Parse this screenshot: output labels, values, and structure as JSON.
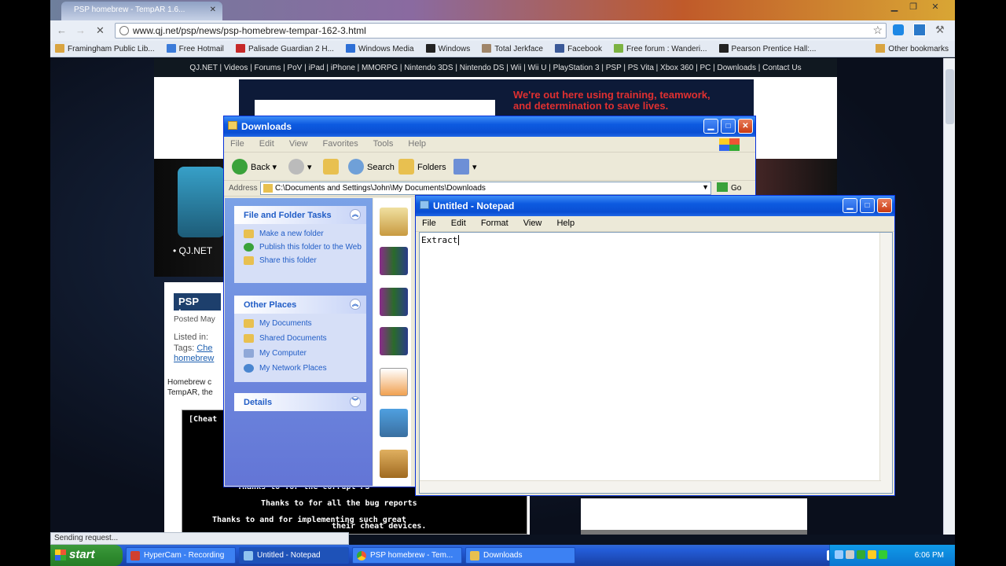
{
  "browser": {
    "tab_title": "PSP homebrew - TempAR 1.6...",
    "url": "www.qj.net/psp/news/psp-homebrew-tempar-162-3.html",
    "bookmarks": [
      "Framingham Public Lib...",
      "Free Hotmail",
      "Palisade Guardian 2 H...",
      "Windows Media",
      "Windows",
      "Total Jerkface",
      "Facebook",
      "Free forum : Wanderi...",
      "Pearson Prentice Hall:..."
    ],
    "other_bookmarks": "Other bookmarks",
    "status": "Sending request..."
  },
  "webpage": {
    "nav": "QJ.NET | Videos | Forums | PoV | iPad | iPhone | MMORPG | Nintendo 3DS | Nintendo DS | Wii | Wii U | PlayStation 3 | PSP | PS Vita | Xbox 360 | PC | Downloads | Contact Us",
    "ad_line1": "We're out here using training, teamwork,",
    "ad_line2": "and determination to save lives.",
    "site_label": "• QJ.NET",
    "article_title": "PSP hom",
    "posted": "Posted May",
    "listed_in": "Listed in:",
    "tags_label": "Tags:",
    "tags_link": "Che",
    "homebrew_link": "homebrew",
    "body1": "Homebrew c",
    "body2": "TempAR, the",
    "cheat_header": "[Cheat",
    "cheat_lines": [
      "Thanks to        for the corrupt PS",
      "Thanks to      for all the bug reports",
      "Thanks to       and        for implementing such great",
      "their cheat devices."
    ]
  },
  "explorer": {
    "title": "Downloads",
    "menu": [
      "File",
      "Edit",
      "View",
      "Favorites",
      "Tools",
      "Help"
    ],
    "toolbar": {
      "back": "Back",
      "search": "Search",
      "folders": "Folders"
    },
    "address_label": "Address",
    "address": "C:\\Documents and Settings\\John\\My Documents\\Downloads",
    "go": "Go",
    "tasks_title": "File and Folder Tasks",
    "tasks": [
      "Make a new folder",
      "Publish this folder to the Web",
      "Share this folder"
    ],
    "places_title": "Other Places",
    "places": [
      "My Documents",
      "Shared Documents",
      "My Computer",
      "My Network Places"
    ],
    "details_title": "Details"
  },
  "notepad": {
    "title": "Untitled - Notepad",
    "menu": [
      "File",
      "Edit",
      "Format",
      "View",
      "Help"
    ],
    "text": "Extract"
  },
  "taskbar": {
    "start": "start",
    "items": [
      "HyperCam - Recording",
      "Untitled - Notepad",
      "PSP homebrew - Tem...",
      "Downloads"
    ],
    "clock": "6:06 PM"
  }
}
